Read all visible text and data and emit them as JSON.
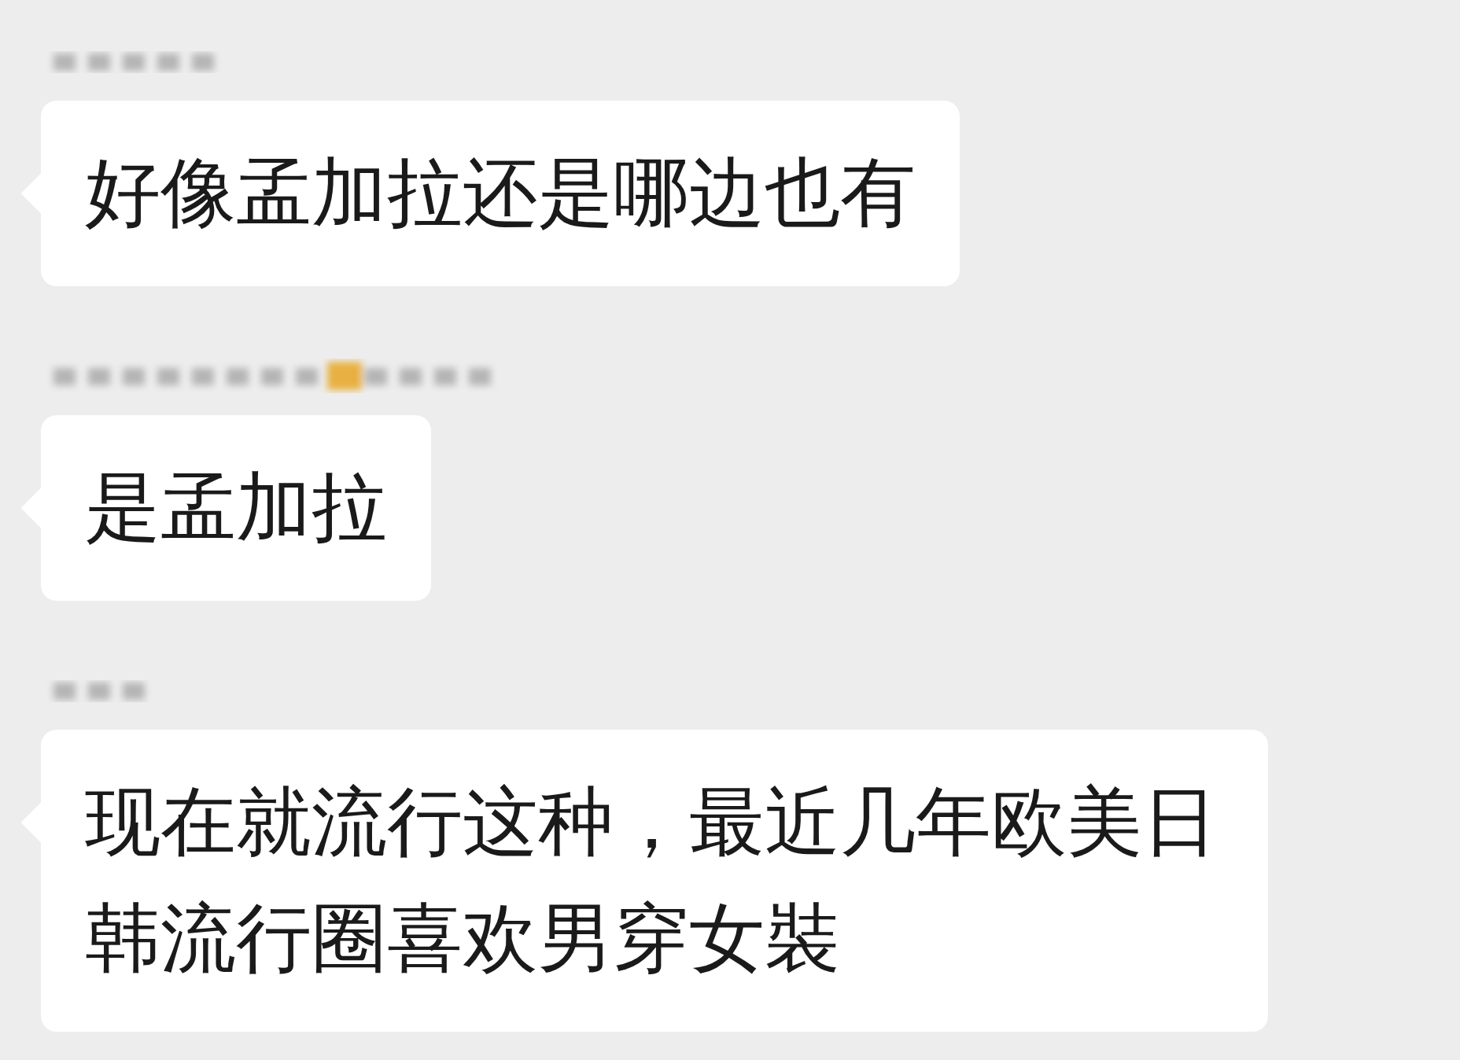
{
  "messages": [
    {
      "text": "好像孟加拉还是哪边也有"
    },
    {
      "text": "是孟加拉"
    },
    {
      "text": "现在就流行这种，最近几年欧美日韩流行圈喜欢男穿女裝"
    }
  ]
}
